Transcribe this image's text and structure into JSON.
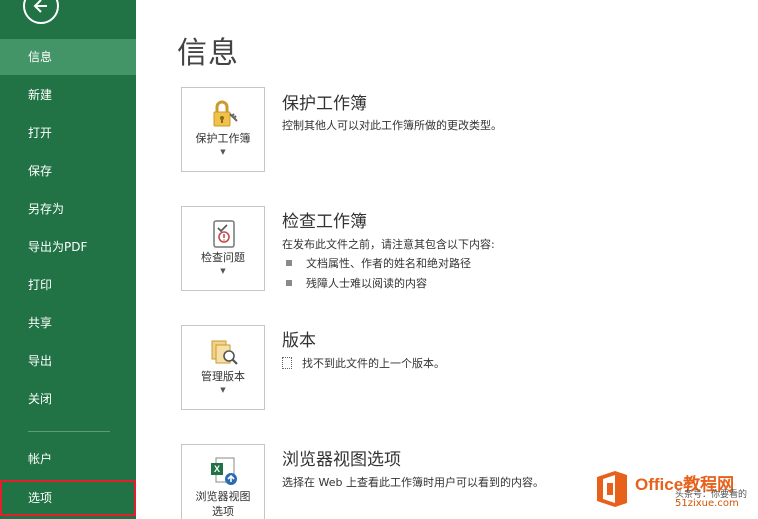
{
  "sidebar": {
    "back_icon": "arrow-left-circle-icon",
    "items": [
      {
        "label": "信息",
        "active": true
      },
      {
        "label": "新建"
      },
      {
        "label": "打开"
      },
      {
        "label": "保存"
      },
      {
        "label": "另存为"
      },
      {
        "label": "导出为PDF"
      },
      {
        "label": "打印"
      },
      {
        "label": "共享"
      },
      {
        "label": "导出"
      },
      {
        "label": "关闭"
      },
      {
        "label": "帐户"
      },
      {
        "label": "选项",
        "highlighted": true
      }
    ],
    "colors": {
      "background": "#217346",
      "active": "#439467",
      "highlight_border": "#e0202a"
    }
  },
  "main": {
    "title": "信息",
    "sections": [
      {
        "tile_label": "保护工作簿",
        "tile_icon": "lock-key-icon",
        "title": "保护工作簿",
        "description": "控制其他人可以对此工作簿所做的更改类型。"
      },
      {
        "tile_label": "检查问题",
        "tile_icon": "inspect-document-icon",
        "title": "检查工作簿",
        "description": "在发布此文件之前，请注意其包含以下内容:",
        "bullets": [
          "文档属性、作者的姓名和绝对路径",
          "残障人士难以阅读的内容"
        ]
      },
      {
        "tile_label": "管理版本",
        "tile_icon": "manage-versions-icon",
        "title": "版本",
        "note": "找不到此文件的上一个版本。"
      },
      {
        "tile_label_line1": "浏览器视图",
        "tile_label_line2": "选项",
        "tile_icon": "browser-view-excel-icon",
        "title": "浏览器视图选项",
        "description": "选择在 Web 上查看此工作簿时用户可以看到的内容。"
      }
    ]
  },
  "watermark": {
    "brand": "Office教程网",
    "sub": "头条号：你要看的",
    "url": "51zixue.com"
  }
}
